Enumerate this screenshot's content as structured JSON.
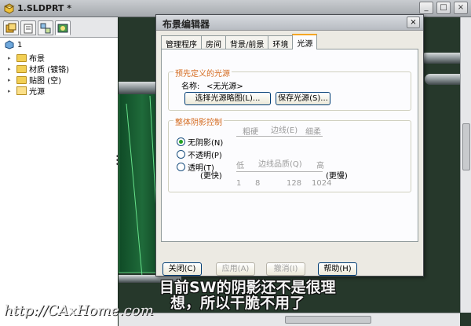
{
  "window": {
    "title": "1.SLDPRT *",
    "controls": [
      "_",
      "□",
      "×"
    ]
  },
  "feature_manager": {
    "tabs": [
      "feature-tree",
      "property-manager",
      "configuration-manager",
      "display-manager"
    ],
    "root_label": "1",
    "items": [
      {
        "label": "布景",
        "icon": "folder-icon"
      },
      {
        "label": "材质 (镀铬)",
        "icon": "folder-icon"
      },
      {
        "label": "贴图 (空)",
        "icon": "folder-icon"
      },
      {
        "label": "光源",
        "icon": "light-icon"
      }
    ]
  },
  "dialog": {
    "title": "布景编辑器",
    "close": "×",
    "tabs": [
      "管理程序",
      "房间",
      "背景/前景",
      "环境",
      "光源"
    ],
    "active_tab": "光源",
    "predefined": {
      "group_label": "预先定义的光源",
      "name_label": "名称:",
      "name_value": "<无光源>",
      "select_button": "选择光源略图(L)...",
      "save_button": "保存光源(S)..."
    },
    "shadow": {
      "group_label": "整体阴影控制",
      "options": [
        "无阴影(N)",
        "不透明(P)",
        "透明(T)"
      ],
      "selected_option": "无阴影(N)",
      "edge_top": [
        "粗硬",
        "边线(E)",
        "细柔"
      ],
      "quality": [
        "低",
        "边线品质(Q)",
        "高"
      ],
      "left_label": "(更快)",
      "right_label": "(更慢)",
      "quality_ticks": [
        "1",
        "8",
        "128",
        "1024"
      ]
    },
    "footer": [
      "关闭(C)",
      "应用(A)",
      "撤消(I)",
      "帮助(H)"
    ],
    "disabled_footer": [
      "应用(A)",
      "撤消(I)"
    ]
  },
  "caption": {
    "line1": "目前SW的阴影还不是很理",
    "line2": "想，所以干脆不用了"
  },
  "watermark": "http://CAxHome.com"
}
